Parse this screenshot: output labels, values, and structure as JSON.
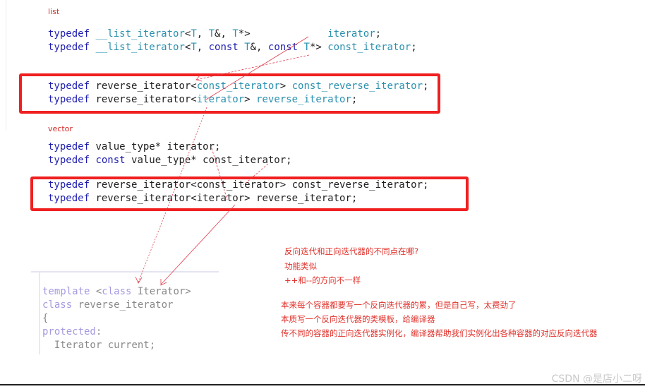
{
  "list_section": {
    "label": "list",
    "lines": [
      [
        {
          "t": "typedef ",
          "c": "kw"
        },
        {
          "t": "__list_iterator",
          "c": "ty"
        },
        {
          "t": "<",
          "c": "pl"
        },
        {
          "t": "T",
          "c": "ty"
        },
        {
          "t": ", ",
          "c": "pl"
        },
        {
          "t": "T",
          "c": "ty"
        },
        {
          "t": "&, ",
          "c": "pl"
        },
        {
          "t": "T",
          "c": "ty"
        },
        {
          "t": "*>             ",
          "c": "pl"
        },
        {
          "t": "iterator",
          "c": "ty"
        },
        {
          "t": ";",
          "c": "pl"
        }
      ],
      [
        {
          "t": "typedef ",
          "c": "kw"
        },
        {
          "t": "__list_iterator",
          "c": "ty"
        },
        {
          "t": "<",
          "c": "pl"
        },
        {
          "t": "T",
          "c": "ty"
        },
        {
          "t": ", ",
          "c": "pl"
        },
        {
          "t": "const ",
          "c": "kw"
        },
        {
          "t": "T",
          "c": "ty"
        },
        {
          "t": "&, ",
          "c": "pl"
        },
        {
          "t": "const ",
          "c": "kw"
        },
        {
          "t": "T",
          "c": "ty"
        },
        {
          "t": "*> ",
          "c": "pl"
        },
        {
          "t": "const_iterator",
          "c": "ty"
        },
        {
          "t": ";",
          "c": "pl"
        }
      ]
    ],
    "boxed_lines": [
      [
        {
          "t": "typedef ",
          "c": "kw"
        },
        {
          "t": "reverse_iterator<",
          "c": "pl"
        },
        {
          "t": "const_iterator",
          "c": "ty"
        },
        {
          "t": "> ",
          "c": "pl"
        },
        {
          "t": "const_reverse_iterator",
          "c": "ty"
        },
        {
          "t": ";",
          "c": "pl"
        }
      ],
      [
        {
          "t": "typedef ",
          "c": "kw"
        },
        {
          "t": "reverse_iterator<",
          "c": "pl"
        },
        {
          "t": "iterator",
          "c": "ty"
        },
        {
          "t": "> ",
          "c": "pl"
        },
        {
          "t": "reverse_iterator",
          "c": "ty"
        },
        {
          "t": ";",
          "c": "pl"
        }
      ]
    ]
  },
  "vector_section": {
    "label": "vector",
    "lines": [
      [
        {
          "t": "typedef ",
          "c": "kw"
        },
        {
          "t": "value_type* iterator;",
          "c": "pl"
        }
      ],
      [
        {
          "t": "typedef ",
          "c": "kw"
        },
        {
          "t": "const ",
          "c": "kw"
        },
        {
          "t": "value_type* const_iterator;",
          "c": "pl"
        }
      ]
    ],
    "boxed_lines": [
      [
        {
          "t": "typedef ",
          "c": "kw"
        },
        {
          "t": "reverse_iterator<const_iterator> const_reverse_iterator;",
          "c": "pl"
        }
      ],
      [
        {
          "t": "typedef ",
          "c": "kw"
        },
        {
          "t": "reverse_iterator<iterator> reverse_iterator;",
          "c": "pl"
        }
      ]
    ]
  },
  "template_snippet": {
    "lines": [
      [
        {
          "t": "template ",
          "c": "gkw"
        },
        {
          "t": "<",
          "c": "gpl"
        },
        {
          "t": "class ",
          "c": "gkw"
        },
        {
          "t": "Iterator>",
          "c": "gpl"
        }
      ],
      [
        {
          "t": "class ",
          "c": "gkw"
        },
        {
          "t": "reverse_iterator",
          "c": "gpl"
        }
      ],
      [
        {
          "t": "{",
          "c": "gpl"
        }
      ],
      [
        {
          "t": "protected",
          "c": "gkw"
        },
        {
          "t": ":",
          "c": "gpl"
        }
      ],
      [
        {
          "t": "  Iterator current;",
          "c": "gpl"
        }
      ]
    ]
  },
  "notes": {
    "question": "反向迭代和正向迭代器的不同点在哪?",
    "answer1": "功能类似",
    "answer2": "++和--的方向不一样",
    "explain1": "本来每个容器都要写一个反向迭代器的累，但是自己写，太费劲了",
    "explain2": "本质写一个反向迭代器的类模板，给编译器",
    "explain3": "传不同的容器的正向迭代器实例化，编译器帮助我们实例化出各种容器的对应反向迭代器"
  },
  "watermark": "CSDN @是店小二呀",
  "colors": {
    "annotation": "#e0302a",
    "box": "#f02020",
    "keyword": "#1f1fb0",
    "type": "#2b91af"
  }
}
